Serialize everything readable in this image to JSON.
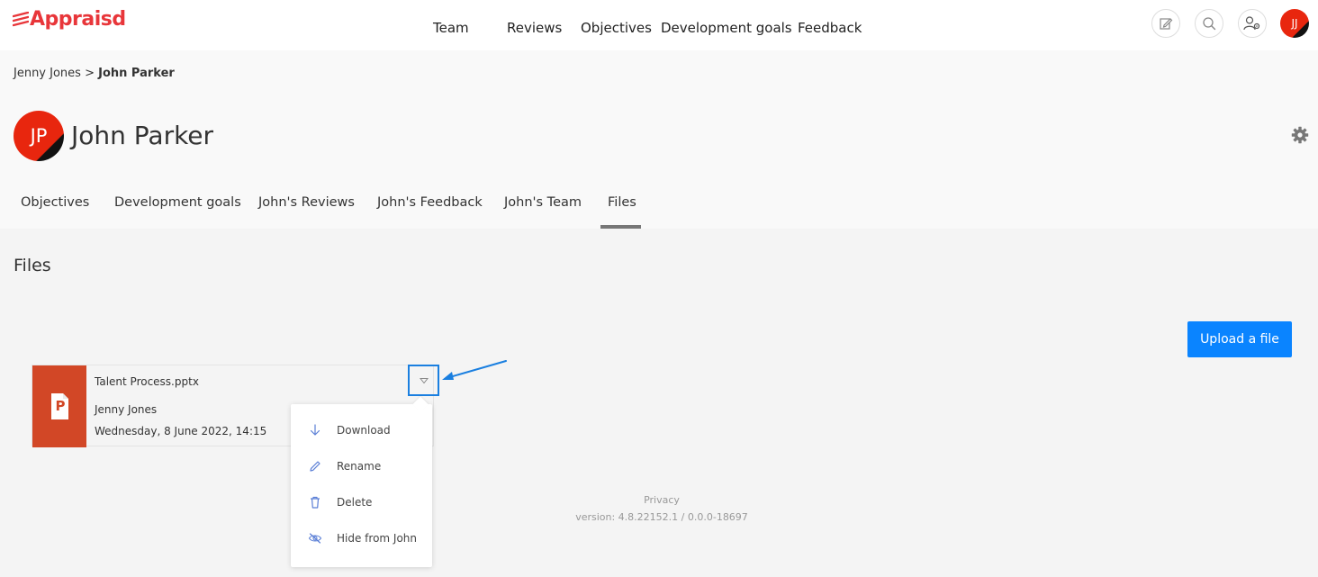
{
  "app": {
    "logo_text": "Appraisd",
    "brand_color": "#e8363a",
    "accent_color": "#0a84ff"
  },
  "nav": {
    "items": [
      {
        "label": "Team"
      },
      {
        "label": "Reviews"
      },
      {
        "label": "Objectives"
      },
      {
        "label": "Development goals"
      },
      {
        "label": "Feedback"
      }
    ],
    "icons": [
      "edit-icon",
      "search-icon",
      "user-settings-icon"
    ],
    "user_initials": "JJ"
  },
  "breadcrumb": {
    "parent": "Jenny Jones",
    "separator": ">",
    "current": "John Parker"
  },
  "profile": {
    "initials": "JP",
    "name": "John Parker"
  },
  "tabs": [
    {
      "label": "Objectives"
    },
    {
      "label": "Development goals"
    },
    {
      "label": "John's Reviews"
    },
    {
      "label": "John's Feedback"
    },
    {
      "label": "John's Team"
    },
    {
      "label": "Files",
      "active": true
    }
  ],
  "files_section": {
    "title": "Files",
    "upload_label": "Upload a file",
    "files": [
      {
        "name": "Talent Process.pptx",
        "owner": "Jenny Jones",
        "date": "Wednesday, 8 June 2022, 14:15",
        "type_icon": "powerpoint-icon",
        "type_letter": "P"
      }
    ]
  },
  "menu": {
    "items": [
      {
        "label": "Download",
        "icon": "download-icon"
      },
      {
        "label": "Rename",
        "icon": "pencil-icon"
      },
      {
        "label": "Delete",
        "icon": "trash-icon"
      },
      {
        "label": "Hide from John",
        "icon": "eye-slash-icon"
      }
    ]
  },
  "footer": {
    "privacy": "Privacy",
    "version": "version: 4.8.22152.1 / 0.0.0-18697"
  }
}
